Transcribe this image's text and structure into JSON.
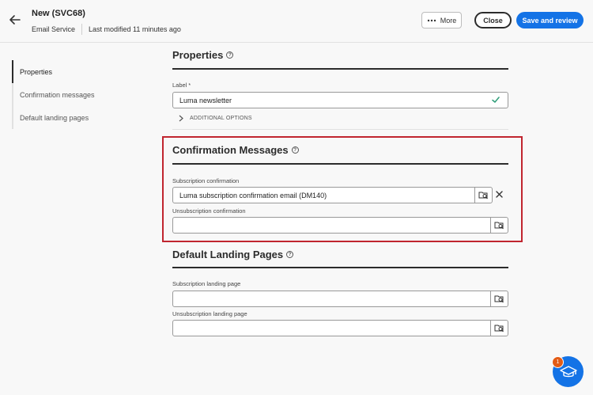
{
  "header": {
    "title": "New (SVC68)",
    "service": "Email Service",
    "modified": "Last modified 11 minutes ago",
    "more_label": "More",
    "close_label": "Close",
    "save_label": "Save and review"
  },
  "nav": {
    "items": [
      {
        "label": "Properties"
      },
      {
        "label": "Confirmation messages"
      },
      {
        "label": "Default landing pages"
      }
    ]
  },
  "properties": {
    "title": "Properties",
    "label_field_label": "Label",
    "required_mark": "*",
    "label_value": "Luma newsletter",
    "additional_options": "ADDITIONAL OPTIONS"
  },
  "confirmation": {
    "title": "Confirmation Messages",
    "subscription_label": "Subscription confirmation",
    "subscription_value": "Luma subscription confirmation email (DM140)",
    "unsubscription_label": "Unsubscription confirmation",
    "unsubscription_value": ""
  },
  "landing": {
    "title": "Default Landing Pages",
    "subscription_label": "Subscription landing page",
    "subscription_value": "",
    "unsubscription_label": "Unsubscription landing page",
    "unsubscription_value": ""
  },
  "help": {
    "badge_count": "1"
  },
  "colors": {
    "accent": "#1473e6",
    "highlight": "#c0252f",
    "success": "#2d9d78",
    "badge": "#e35c16"
  },
  "icons": [
    "back-arrow-icon",
    "more-dots-icon",
    "help-icon",
    "checkmark-icon",
    "chevron-right-icon",
    "folder-search-icon",
    "close-icon",
    "graduation-cap-icon"
  ]
}
